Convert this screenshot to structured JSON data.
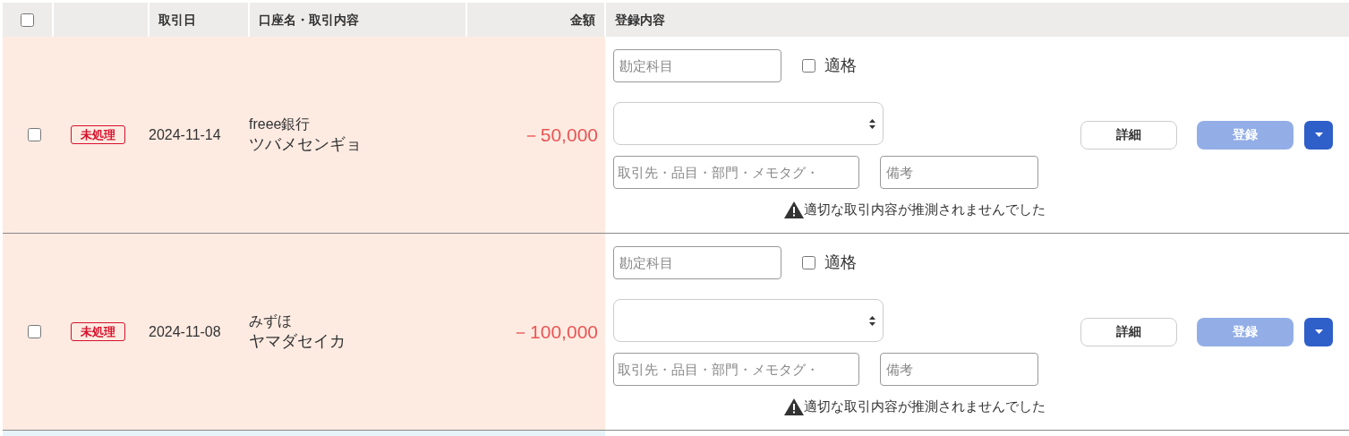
{
  "select_all": {
    "checked": false
  },
  "columns": [
    {
      "label": "取引日"
    },
    {
      "label": "口座名・取引内容"
    },
    {
      "label": "金額"
    },
    {
      "label": "登録内容"
    }
  ],
  "rows": [
    {
      "checked": false,
      "status": "未処理",
      "date": "2024-11-14",
      "account": "freee銀行",
      "description": "ツバメセンギョ",
      "amount": "－50,000",
      "account_field": {
        "placeholder": "勘定科目"
      },
      "qualified": {
        "label": "適格",
        "checked": false
      },
      "partner_field": {
        "placeholder": "取引先・品目・部門・メモタグ・"
      },
      "memo_field": {
        "placeholder": "備考"
      },
      "warning": "適切な取引内容が推測されませんでした",
      "detail_button": "詳細",
      "register_button": {
        "label": "登録",
        "disabled": true
      }
    },
    {
      "checked": false,
      "status": "未処理",
      "date": "2024-11-08",
      "account": "みずほ",
      "description": "ヤマダセイカ",
      "amount": "－100,000",
      "account_field": {
        "placeholder": "勘定科目"
      },
      "qualified": {
        "label": "適格",
        "checked": false
      },
      "partner_field": {
        "placeholder": "取引先・品目・部門・メモタグ・"
      },
      "memo_field": {
        "placeholder": "備考"
      },
      "warning": "適切な取引内容が推測されませんでした",
      "detail_button": "詳細",
      "register_button": {
        "label": "登録",
        "disabled": true
      }
    }
  ]
}
